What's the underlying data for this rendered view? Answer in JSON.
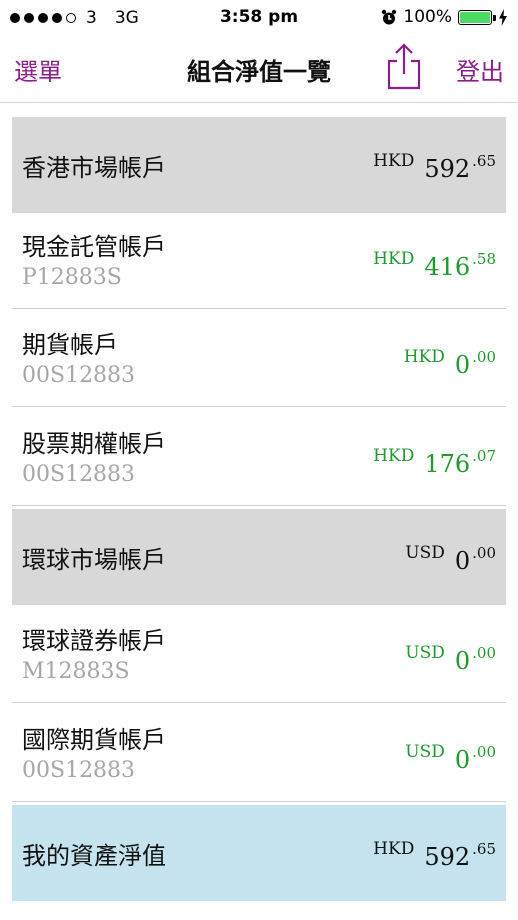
{
  "status_bar": {
    "carrier": "3",
    "network": "3G",
    "time": "3:58 pm",
    "battery": "100%"
  },
  "nav": {
    "menu_label": "選單",
    "title": "組合淨值一覽",
    "logout_label": "登出"
  },
  "colors": {
    "accent": "#8a1f8a",
    "positive": "#1e9a2c",
    "section_bg": "#d8d8d8",
    "total_bg": "#c4e3ee"
  },
  "accounts": [
    {
      "name": "香港市場帳戶",
      "account_no": "",
      "currency": "HKD",
      "integer": "592",
      "decimal": ".65"
    },
    {
      "name": "現金託管帳戶",
      "account_no": "P12883S",
      "currency": "HKD",
      "integer": "416",
      "decimal": ".58"
    },
    {
      "name": "期貨帳戶",
      "account_no": "00S12883",
      "currency": "HKD",
      "integer": "0",
      "decimal": ".00"
    },
    {
      "name": "股票期權帳戶",
      "account_no": "00S12883",
      "currency": "HKD",
      "integer": "176",
      "decimal": ".07"
    },
    {
      "name": "環球市場帳戶",
      "account_no": "",
      "currency": "USD",
      "integer": "0",
      "decimal": ".00"
    },
    {
      "name": "環球證券帳戶",
      "account_no": "M12883S",
      "currency": "USD",
      "integer": "0",
      "decimal": ".00"
    },
    {
      "name": "國際期貨帳戶",
      "account_no": "00S12883",
      "currency": "USD",
      "integer": "0",
      "decimal": ".00"
    },
    {
      "name": "我的資產淨值",
      "account_no": "",
      "currency": "HKD",
      "integer": "592",
      "decimal": ".65"
    }
  ]
}
